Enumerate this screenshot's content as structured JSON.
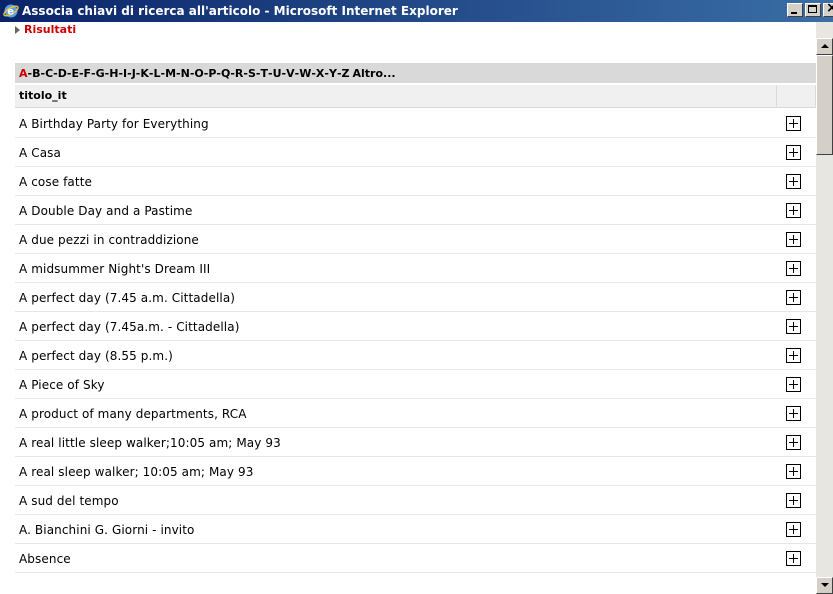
{
  "window": {
    "title": "Associa chiavi di ricerca all'articolo - Microsoft Internet Explorer"
  },
  "results_link": "Risultati",
  "alphabet": {
    "letters": [
      "A",
      "B",
      "C",
      "D",
      "E",
      "F",
      "G",
      "H",
      "I",
      "J",
      "K",
      "L",
      "M",
      "N",
      "O",
      "P",
      "Q",
      "R",
      "S",
      "T",
      "U",
      "V",
      "W",
      "X",
      "Y",
      "Z"
    ],
    "active": "A",
    "more_label": "Altro..."
  },
  "table": {
    "column_header": "titolo_it",
    "rows": [
      "A Birthday Party for Everything",
      "A Casa",
      "A cose fatte",
      "A Double Day and a Pastime",
      "A due pezzi in contraddizione",
      "A midsummer Night's Dream III",
      "A perfect day (7.45 a.m. Cittadella)",
      "A perfect day (7.45a.m. - Cittadella)",
      "A perfect day (8.55 p.m.)",
      "A Piece of Sky",
      "A product of many departments, RCA",
      "A real little sleep walker;10:05 am; May 93",
      "A real sleep walker; 10:05 am; May 93",
      "A sud del tempo",
      "A. Bianchini G. Giorni - invito",
      "Absence"
    ],
    "row_action_icon": "plus-box-icon"
  },
  "colors": {
    "titlebar_start": "#0a246a",
    "titlebar_end": "#3a6ea5",
    "accent_red": "#cc0000",
    "alpha_bar_bg": "#d9d9d9"
  }
}
